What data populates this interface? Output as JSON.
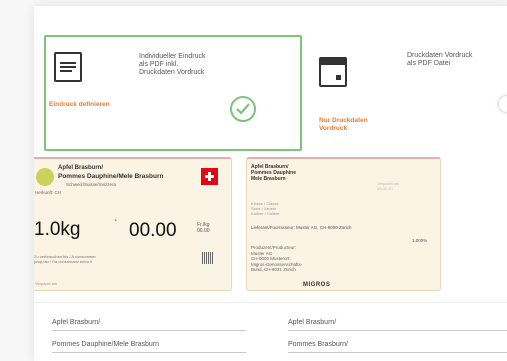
{
  "options": [
    {
      "description": "Individueller Eindruck\nals PDF inkl.\nDruckdaten Vordruck",
      "action": "Eindruck definieren",
      "selected": true,
      "icon": "document-lines-icon"
    },
    {
      "description": "Druckdaten Vordruck\nals PDF Datei",
      "action": "Nur Druckdaten\nVordruck",
      "selected": false,
      "icon": "document-window-icon"
    }
  ],
  "label_preview": {
    "title_small": "Apfel Brasburn/",
    "product_name": "Pommes Dauphine/Mele Brasburn",
    "subtitle": "Schweiz/Suisse/Svizzera",
    "origin": "Herkunft: CH",
    "weight": "1.0kg",
    "tick": "`",
    "price": "00.00",
    "unit_note": "Fr./kg\n00.00",
    "fine_print": "Zu verbrauchen bis / A consommer\njusqu'au / Da consumarsi entro il",
    "footer_note": "Verpackt am",
    "flag_color": "#e20613"
  },
  "label_back": {
    "header": "Apfel Brasburn/\nPommes Dauphine\nMele Brasburn",
    "gray_note": "Verpackt am\n00.00.00",
    "mid_text": "Klasse / Classe\nSorte / Variete\nKaliber / Calibre",
    "address": "Lieferant/Fournisseur: Muster AG, CH-8000 Zürich",
    "percent": "1.000%",
    "bottom_text": "Produzent/Producteur:\nMuster AG\nCH-0000 Musterort\nMigros-Genossenschafts-\nBund, CH-8031 Zürich",
    "brand": "MIGROS"
  },
  "fields": [
    {
      "value": "Apfel Brasburn/"
    },
    {
      "value": "Apfel Brasburn/"
    },
    {
      "value": "Pommes Dauphine/Mele Brasburn"
    },
    {
      "value": "Pommes Brasburn/"
    }
  ],
  "colors": {
    "accent_green": "#7cc47a",
    "accent_orange": "#e87b2a",
    "label_bg": "#fbf3e3"
  }
}
